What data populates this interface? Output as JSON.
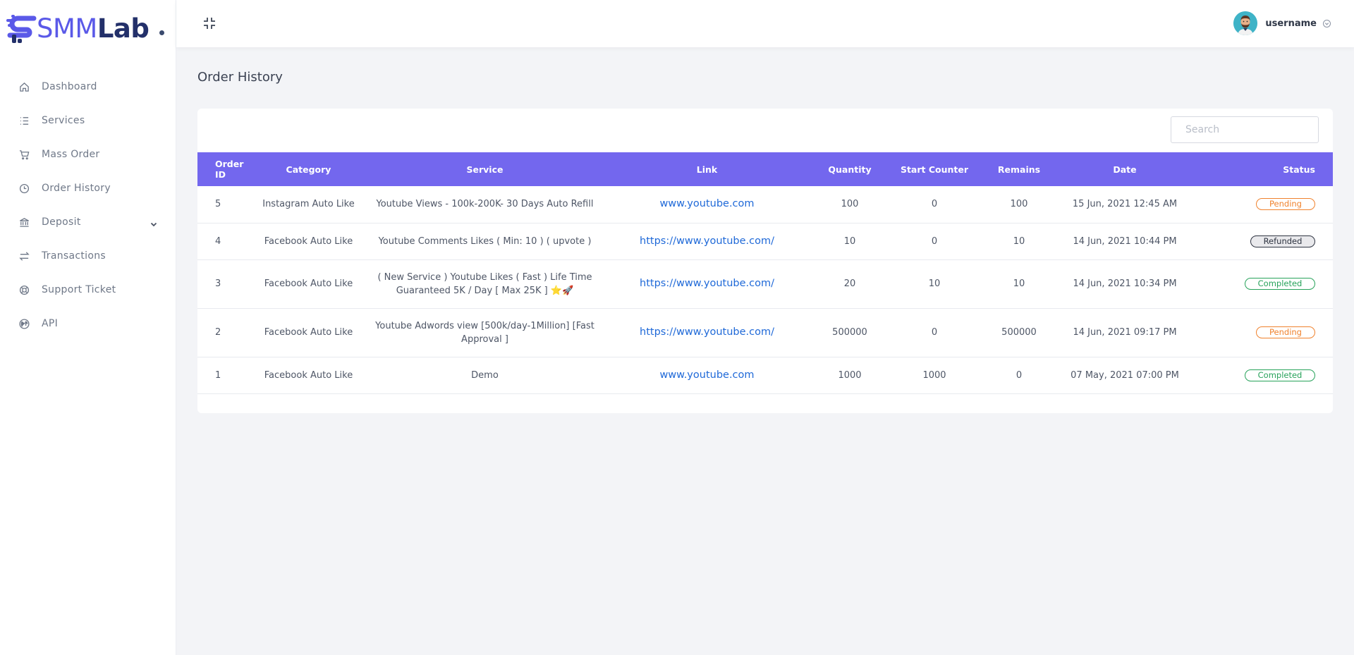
{
  "app": {
    "logo_smm": "SMM",
    "logo_lab": "Lab"
  },
  "sidebar": {
    "items": [
      {
        "label": "Dashboard",
        "icon": "home-icon"
      },
      {
        "label": "Services",
        "icon": "list-icon"
      },
      {
        "label": "Mass Order",
        "icon": "cart-icon"
      },
      {
        "label": "Order History",
        "icon": "clock-icon"
      },
      {
        "label": "Deposit",
        "icon": "bank-icon",
        "has_submenu": true
      },
      {
        "label": "Transactions",
        "icon": "exchange-icon"
      },
      {
        "label": "Support Ticket",
        "icon": "lifebuoy-icon"
      },
      {
        "label": "API",
        "icon": "globe-icon"
      }
    ]
  },
  "header": {
    "username": "username"
  },
  "main": {
    "title": "Order History",
    "search_placeholder": "Search",
    "columns": [
      "Order ID",
      "Category",
      "Service",
      "Link",
      "Quantity",
      "Start Counter",
      "Remains",
      "Date",
      "Status"
    ],
    "rows": [
      {
        "id": "5",
        "category": "Instagram Auto Like",
        "service": "Youtube Views - 100k-200K- 30 Days Auto Refill",
        "link": "www.youtube.com",
        "quantity": "100",
        "start_counter": "0",
        "remains": "100",
        "date": "15 Jun, 2021 12:45 AM",
        "status": "Pending"
      },
      {
        "id": "4",
        "category": "Facebook Auto Like",
        "service": "Youtube Comments Likes ( Min: 10 ) ( upvote )",
        "link": "https://www.youtube.com/",
        "quantity": "10",
        "start_counter": "0",
        "remains": "10",
        "date": "14 Jun, 2021 10:44 PM",
        "status": "Refunded"
      },
      {
        "id": "3",
        "category": "Facebook Auto Like",
        "service": "( New Service ) Youtube Likes ( Fast ) Life Time Guaranteed 5K / Day [ Max 25K ] ⭐🚀",
        "link": "https://www.youtube.com/",
        "quantity": "20",
        "start_counter": "10",
        "remains": "10",
        "date": "14 Jun, 2021 10:34 PM",
        "status": "Completed"
      },
      {
        "id": "2",
        "category": "Facebook Auto Like",
        "service": "Youtube Adwords view [500k/day-1Million] [Fast Approval ]",
        "link": "https://www.youtube.com/",
        "quantity": "500000",
        "start_counter": "0",
        "remains": "500000",
        "date": "14 Jun, 2021 09:17 PM",
        "status": "Pending"
      },
      {
        "id": "1",
        "category": "Facebook Auto Like",
        "service": "Demo",
        "link": "www.youtube.com",
        "quantity": "1000",
        "start_counter": "1000",
        "remains": "0",
        "date": "07 May, 2021 07:00 PM",
        "status": "Completed"
      }
    ]
  },
  "colors": {
    "accent": "#7367ee",
    "pending": "#f0822d",
    "completed": "#27a25a",
    "refunded": "#2d3340",
    "link": "#1f69d8"
  }
}
